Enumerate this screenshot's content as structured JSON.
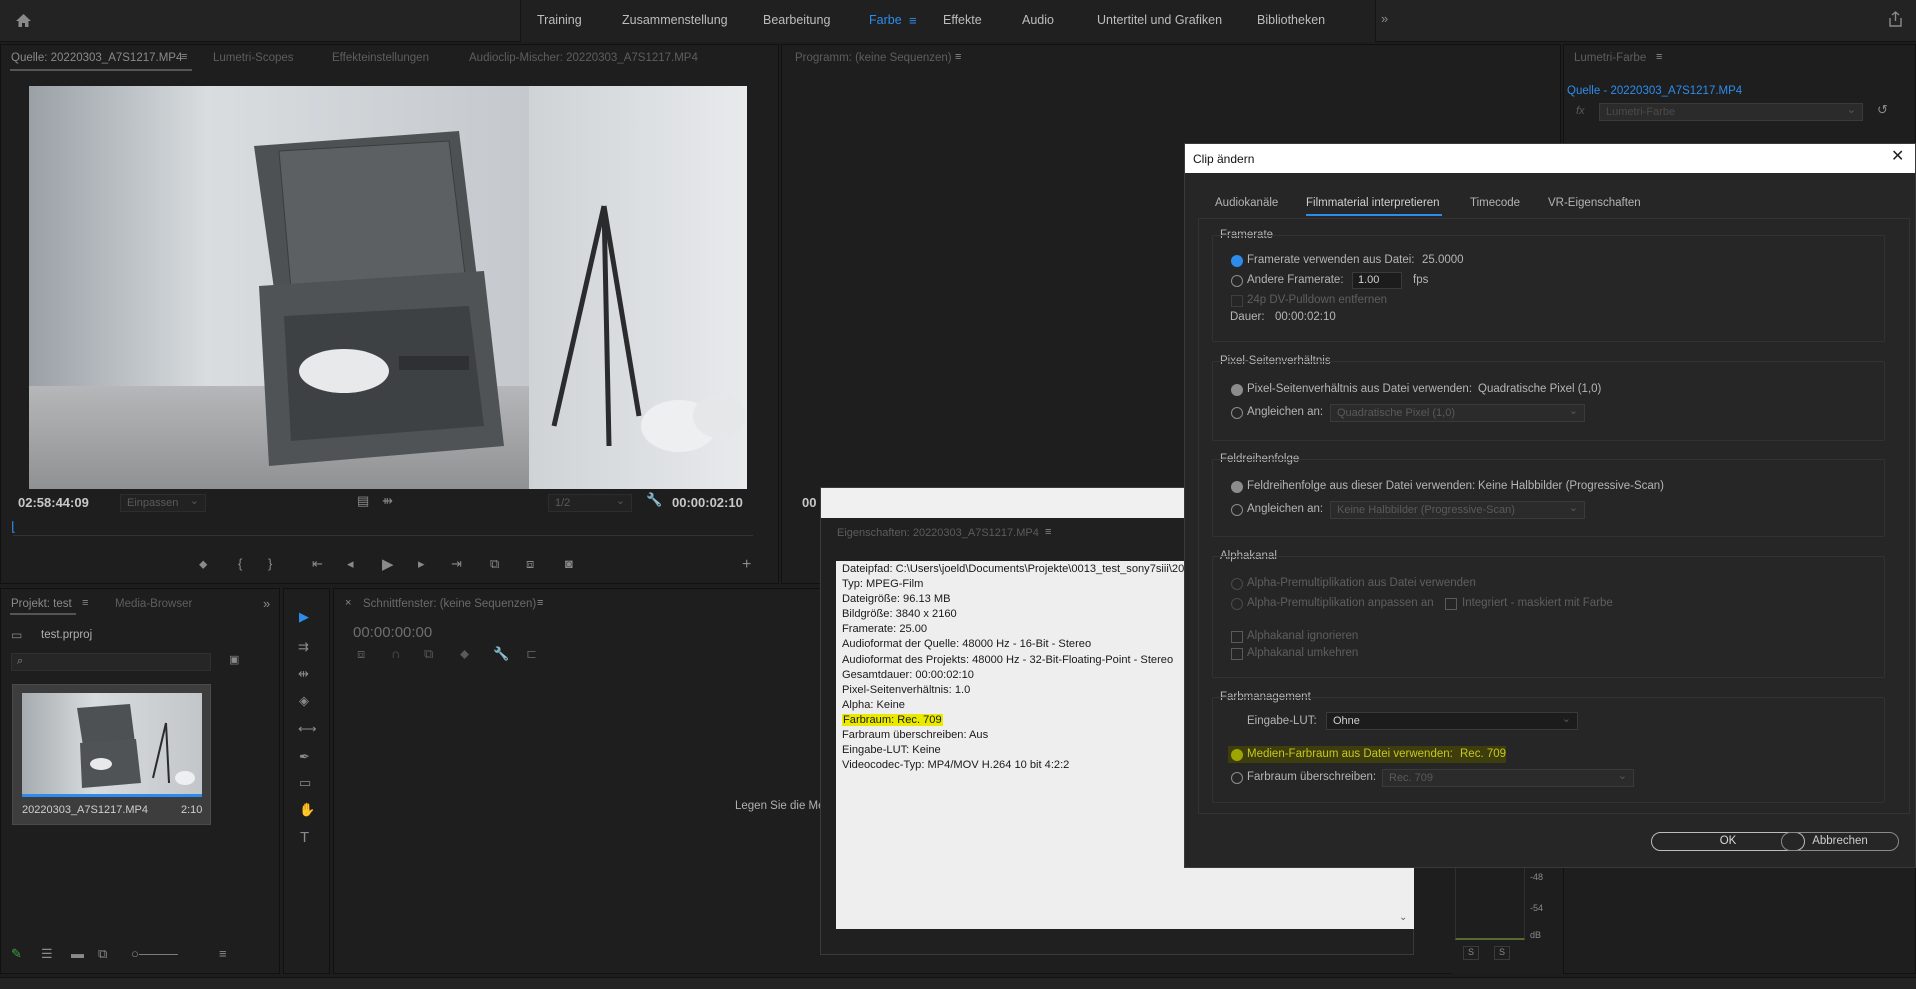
{
  "workspaces": [
    "Training",
    "Zusammenstellung",
    "Bearbeitung",
    "Farbe",
    "Effekte",
    "Audio",
    "Untertitel und Grafiken",
    "Bibliotheken"
  ],
  "colors": {
    "accent": "#2d8ceb",
    "highlight": "#eaea00",
    "medien_yellow": "#c8c81e"
  },
  "source_panel": {
    "tabs": [
      "Quelle: 20220303_A7S1217.MP4",
      "Lumetri-Scopes",
      "Effekteinstellungen",
      "Audioclip-Mischer: 20220303_A7S1217.MP4"
    ],
    "timecode_left": "02:58:44:09",
    "fit": "Einpassen",
    "resolution": "1/2",
    "timecode_right": "00:00:02:10"
  },
  "program_panel": {
    "tab": "Programm: (keine Sequenzen)",
    "timecode_partial": "00"
  },
  "lumetri_panel": {
    "tab": "Lumetri-Farbe",
    "source": "Quelle - 20220303_A7S1217.MP4",
    "fx": "fx",
    "effect": "Lumetri-Farbe"
  },
  "project_panel": {
    "tabs": [
      "Projekt: test",
      "Media-Browser"
    ],
    "project_file": "test.prproj",
    "clip_name": "20220303_A7S1217.MP4",
    "clip_duration": "2:10"
  },
  "timeline_panel": {
    "tab": "Schnittfenster: (keine Sequenzen)",
    "timecode": "00:00:00:00",
    "drop_hint": "Legen Sie die Me"
  },
  "properties": {
    "title": "Eigenschaften: 20220303_A7S1217.MP4",
    "lines": [
      "Dateipfad: C:\\Users\\joeld\\Documents\\Projekte\\0013_test_sony7siii\\20",
      "Typ: MPEG-Film",
      "Dateigröße: 96.13 MB",
      "Bildgröße: 3840 x 2160",
      "Framerate: 25.00",
      "Audioformat der Quelle: 48000 Hz - 16-Bit - Stereo",
      "Audioformat des Projekts: 48000 Hz - 32-Bit-Floating-Point - Stereo",
      "Gesamtdauer: 00:00:02:10",
      "Pixel-Seitenverhältnis: 1.0",
      "Alpha: Keine",
      "Farbraum: Rec. 709",
      "Farbraum überschreiben: Aus",
      "Eingabe-LUT: Keine",
      "Videocodec-Typ: MP4/MOV H.264 10 bit  4:2:2"
    ]
  },
  "audio_meter": {
    "ticks": [
      "-48",
      "-54",
      "dB"
    ],
    "solo": "S"
  },
  "dialog": {
    "title": "Clip ändern",
    "tabs": [
      "Audiokanäle",
      "Filmmaterial interpretieren",
      "Timecode",
      "VR-Eigenschaften"
    ],
    "framerate": {
      "heading": "Framerate",
      "use_file": "Framerate verwenden aus Datei:",
      "file_value": "25.0000",
      "other": "Andere Framerate:",
      "other_value": "1.00",
      "fps": "fps",
      "pulldown": "24p DV-Pulldown entfernen",
      "duration_label": "Dauer:",
      "duration_value": "00:00:02:10"
    },
    "pixel": {
      "heading": "Pixel-Seitenverhältnis",
      "use_file": "Pixel-Seitenverhältnis aus Datei verwenden:",
      "file_value": "Quadratische Pixel (1,0)",
      "conform": "Angleichen an:",
      "conform_value": "Quadratische Pixel (1,0)"
    },
    "field": {
      "heading": "Feldreihenfolge",
      "use_file": "Feldreihenfolge aus dieser Datei verwenden:",
      "file_value": "Keine Halbbilder (Progressive-Scan)",
      "conform": "Angleichen an:",
      "conform_value": "Keine Halbbilder (Progressive-Scan)"
    },
    "alpha": {
      "heading": "Alphakanal",
      "premult_file": "Alpha-Premultiplikation aus Datei verwenden",
      "premult_adjust": "Alpha-Premultiplikation anpassen an",
      "integrated": "Integriert - maskiert mit Farbe",
      "ignore": "Alphakanal ignorieren",
      "invert": "Alphakanal umkehren"
    },
    "color": {
      "heading": "Farbmanagement",
      "lut_label": "Eingabe-LUT:",
      "lut_value": "Ohne",
      "media": "Medien-Farbraum aus Datei verwenden:",
      "media_value": "Rec. 709",
      "override": "Farbraum überschreiben:",
      "override_value": "Rec. 709"
    },
    "ok": "OK",
    "cancel": "Abbrechen"
  }
}
